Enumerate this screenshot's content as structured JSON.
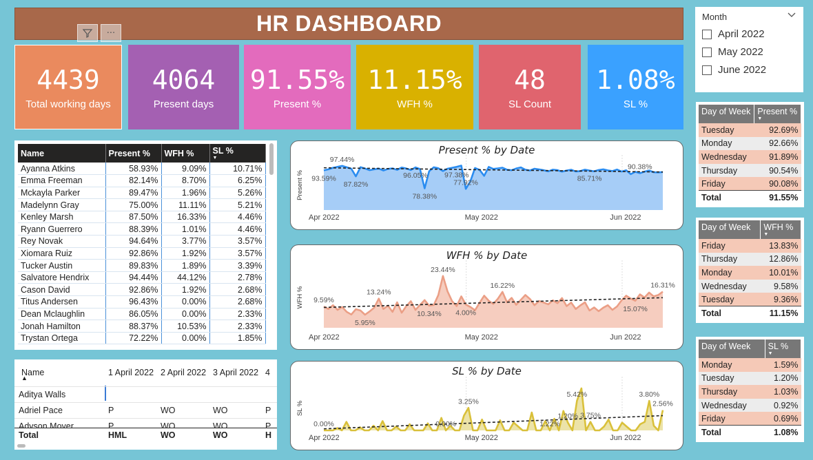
{
  "header": {
    "title": "HR DASHBOARD"
  },
  "visual_header": {
    "filter_icon": "filter-icon",
    "more_label": "···"
  },
  "kpis": [
    {
      "value": "4439",
      "label": "Total working days",
      "color": "#ea8a5e"
    },
    {
      "value": "4064",
      "label": "Present days",
      "color": "#a460b2"
    },
    {
      "value": "91.55%",
      "label": "Present %",
      "color": "#e36bbd"
    },
    {
      "value": "11.15%",
      "label": "WFH %",
      "color": "#d9b100"
    },
    {
      "value": "48",
      "label": "SL Count",
      "color": "#e0646e"
    },
    {
      "value": "1.08%",
      "label": "SL %",
      "color": "#3aa1ff"
    }
  ],
  "slicer": {
    "title": "Month",
    "options": [
      "April 2022",
      "May 2022",
      "June 2022"
    ]
  },
  "present_table": {
    "headers": [
      "Day of Week",
      "Present %"
    ],
    "rows": [
      [
        "Tuesday",
        "92.69%"
      ],
      [
        "Monday",
        "92.66%"
      ],
      [
        "Wednesday",
        "91.89%"
      ],
      [
        "Thursday",
        "90.54%"
      ],
      [
        "Friday",
        "90.08%"
      ]
    ],
    "total": [
      "Total",
      "91.55%"
    ]
  },
  "wfh_table": {
    "headers": [
      "Day of Week",
      "WFH %"
    ],
    "rows": [
      [
        "Friday",
        "13.83%"
      ],
      [
        "Thursday",
        "12.86%"
      ],
      [
        "Monday",
        "10.01%"
      ],
      [
        "Wednesday",
        "9.58%"
      ],
      [
        "Tuesday",
        "9.36%"
      ]
    ],
    "total": [
      "Total",
      "11.15%"
    ]
  },
  "sl_table": {
    "headers": [
      "Day of Week",
      "SL %"
    ],
    "rows": [
      [
        "Monday",
        "1.59%"
      ],
      [
        "Tuesday",
        "1.20%"
      ],
      [
        "Thursday",
        "1.03%"
      ],
      [
        "Wednesday",
        "0.92%"
      ],
      [
        "Friday",
        "0.69%"
      ]
    ],
    "total": [
      "Total",
      "1.08%"
    ]
  },
  "employee_table": {
    "headers": [
      "Name",
      "Present %",
      "WFH %",
      "SL %"
    ],
    "rows": [
      [
        "Ayanna Atkins",
        "58.93%",
        "9.09%",
        "10.71%"
      ],
      [
        "Emma Freeman",
        "82.14%",
        "8.70%",
        "6.25%"
      ],
      [
        "Mckayla Parker",
        "89.47%",
        "1.96%",
        "5.26%"
      ],
      [
        "Madelynn Gray",
        "75.00%",
        "11.11%",
        "5.21%"
      ],
      [
        "Kenley Marsh",
        "87.50%",
        "16.33%",
        "4.46%"
      ],
      [
        "Ryann Guerrero",
        "88.39%",
        "1.01%",
        "4.46%"
      ],
      [
        "Rey Novak",
        "94.64%",
        "3.77%",
        "3.57%"
      ],
      [
        "Xiomara Ruiz",
        "92.86%",
        "1.92%",
        "3.57%"
      ],
      [
        "Tucker Austin",
        "89.83%",
        "1.89%",
        "3.39%"
      ],
      [
        "Salvatore Hendrix",
        "94.44%",
        "44.12%",
        "2.78%"
      ],
      [
        "Cason David",
        "92.86%",
        "1.92%",
        "2.68%"
      ],
      [
        "Titus Andersen",
        "96.43%",
        "0.00%",
        "2.68%"
      ],
      [
        "Dean Mclaughlin",
        "86.05%",
        "0.00%",
        "2.33%"
      ],
      [
        "Jonah Hamilton",
        "88.37%",
        "10.53%",
        "2.33%"
      ],
      [
        "Trystan Ortega",
        "72.22%",
        "0.00%",
        "1.85%"
      ]
    ]
  },
  "matrix": {
    "headers": [
      "Name",
      "1 April 2022",
      "2 April 2022",
      "3 April 2022",
      "4"
    ],
    "rows": [
      [
        "Aditya Walls",
        "",
        "",
        "",
        ""
      ],
      [
        "Adriel Pace",
        "P",
        "WO",
        "WO",
        "P"
      ],
      [
        "Adyson Moyer",
        "P",
        "WO",
        "WO",
        "P"
      ]
    ],
    "total": [
      "Total",
      "HML",
      "WO",
      "WO",
      "H"
    ]
  },
  "chart_data": [
    {
      "type": "area",
      "title": "Present % by Date",
      "ylabel": "Present %",
      "xticks": [
        "Apr 2022",
        "May 2022",
        "Jun 2022"
      ],
      "color": "#2a8cf0",
      "fill": "#a6cdf7",
      "ylim": [
        60,
        102
      ],
      "values": [
        93.6,
        94.5,
        95.8,
        96.6,
        97.4,
        96.2,
        95.0,
        88.5,
        96.3,
        95.2,
        93.8,
        94.5,
        95.1,
        93.5,
        94.8,
        95.3,
        94.0,
        96.0,
        95.2,
        93.9,
        96.1,
        94.7,
        78.4,
        92.9,
        96.2,
        95.4,
        93.0,
        95.0,
        95.8,
        96.6,
        97.6,
        77.9,
        84.5,
        95.6,
        94.0,
        89.0,
        96.5,
        94.8,
        95.3,
        95.8,
        94.1,
        93.7,
        95.2,
        96.1,
        94.2,
        93.5,
        95.0,
        94.4,
        93.7,
        92.8,
        94.2,
        93.8,
        92.5,
        93.5,
        94.1,
        92.6,
        93.0,
        94.2,
        93.5,
        92.8,
        93.9,
        94.5,
        93.6,
        93.0,
        94.3,
        92.6,
        93.7,
        90.4,
        92.4,
        91.2,
        92.5,
        93.5,
        92.0,
        91.8,
        92.2
      ],
      "labels": [
        {
          "i": 0,
          "text": "93.59%",
          "pos": "below"
        },
        {
          "i": 4,
          "text": "97.44%",
          "pos": "above"
        },
        {
          "i": 7,
          "text": "87.82%",
          "pos": "below"
        },
        {
          "i": 20,
          "text": "96.05%",
          "pos": "below"
        },
        {
          "i": 22,
          "text": "78.38%",
          "pos": "below"
        },
        {
          "i": 29,
          "text": "97.38%",
          "pos": "below"
        },
        {
          "i": 31,
          "text": "77.92%",
          "pos": "above"
        },
        {
          "i": 58,
          "text": "85.71%",
          "pos": "below"
        },
        {
          "i": 69,
          "text": "90.38%",
          "pos": "above"
        }
      ],
      "trend": [
        95.8,
        92.2
      ]
    },
    {
      "type": "area",
      "title": "WFH % by Date",
      "ylabel": "WFH %",
      "xticks": [
        "Apr 2022",
        "May 2022",
        "Jun 2022"
      ],
      "color": "#eb9f86",
      "fill": "#f6cdbf",
      "ylim": [
        0,
        28
      ],
      "values": [
        9.6,
        8.5,
        10.2,
        8.1,
        9.4,
        7.2,
        6.0,
        8.4,
        7.8,
        5.9,
        7.4,
        9.1,
        13.2,
        8.5,
        10.0,
        7.2,
        11.5,
        6.8,
        9.8,
        12.0,
        8.1,
        10.3,
        12.5,
        10.0,
        10.3,
        14.8,
        23.4,
        16.5,
        12.0,
        9.8,
        14.2,
        10.5,
        9.4,
        7.9,
        11.3,
        14.5,
        12.2,
        10.8,
        13.1,
        16.2,
        11.5,
        13.5,
        10.4,
        12.6,
        14.8,
        13.0,
        10.2,
        12.1,
        11.4,
        10.6,
        12.4,
        11.1,
        13.4,
        9.8,
        11.4,
        8.5,
        10.1,
        11.5,
        7.8,
        9.2,
        7.5,
        9.1,
        10.2,
        8.1,
        9.6,
        12.4,
        14.5,
        13.2,
        12.2,
        15.1,
        13.7,
        15.9,
        14.2,
        14.8,
        16.3
      ],
      "labels": [
        {
          "i": 0,
          "text": "9.59%",
          "pos": "above"
        },
        {
          "i": 12,
          "text": "13.24%",
          "pos": "above"
        },
        {
          "i": 9,
          "text": "5.95%",
          "pos": "below"
        },
        {
          "i": 26,
          "text": "23.44%",
          "pos": "above"
        },
        {
          "i": 23,
          "text": "10.34%",
          "pos": "below"
        },
        {
          "i": 31,
          "text": "4.00%",
          "pos": "below"
        },
        {
          "i": 39,
          "text": "16.22%",
          "pos": "above"
        },
        {
          "i": 68,
          "text": "15.07%",
          "pos": "below"
        },
        {
          "i": 74,
          "text": "16.31%",
          "pos": "above"
        }
      ],
      "trend": [
        9.2,
        13.6
      ]
    },
    {
      "type": "area",
      "title": "SL % by Date",
      "ylabel": "SL %",
      "xticks": [
        "Apr 2022",
        "May 2022",
        "Jun 2022"
      ],
      "color": "#d9c03a",
      "fill": "#ece3a8",
      "ylim": [
        0,
        6.2
      ],
      "values": [
        0.0,
        0.0,
        0.0,
        0.3,
        0.0,
        1.1,
        0.0,
        0.0,
        0.4,
        0.0,
        0.0,
        0.6,
        0.0,
        1.2,
        0.0,
        0.0,
        0.5,
        0.0,
        0.0,
        0.8,
        0.0,
        0.0,
        0.0,
        0.9,
        0.0,
        0.0,
        1.6,
        0.0,
        0.6,
        0.0,
        0.0,
        1.9,
        2.9,
        0.0,
        0.0,
        1.4,
        0.0,
        0.0,
        0.0,
        1.3,
        0.0,
        0.0,
        1.0,
        0.5,
        0.0,
        0.0,
        2.3,
        0.0,
        0.0,
        1.2,
        0.0,
        1.5,
        0.0,
        2.5,
        1.0,
        0.0,
        3.8,
        5.4,
        0.0,
        1.1,
        0.0,
        0.0,
        0.5,
        1.4,
        0.0,
        0.0,
        1.0,
        0.5,
        0.0,
        0.0,
        0.8,
        1.1,
        3.8,
        0.6,
        0.0,
        2.6
      ],
      "labels": [
        {
          "i": 0,
          "text": "0.00%",
          "pos": "above"
        },
        {
          "i": 27,
          "text": "0.00%",
          "pos": "above"
        },
        {
          "i": 32,
          "text": "3.25%",
          "pos": "above"
        },
        {
          "i": 50,
          "text": "1.22%",
          "pos": "above"
        },
        {
          "i": 54,
          "text": "1.20%",
          "pos": "above"
        },
        {
          "i": 56,
          "text": "5.42%",
          "pos": "above"
        },
        {
          "i": 59,
          "text": "3.75%",
          "pos": "above"
        },
        {
          "i": 72,
          "text": "3.80%",
          "pos": "above"
        },
        {
          "i": 75,
          "text": "2.56%",
          "pos": "above"
        }
      ],
      "trend": [
        0.2,
        1.9
      ]
    }
  ]
}
